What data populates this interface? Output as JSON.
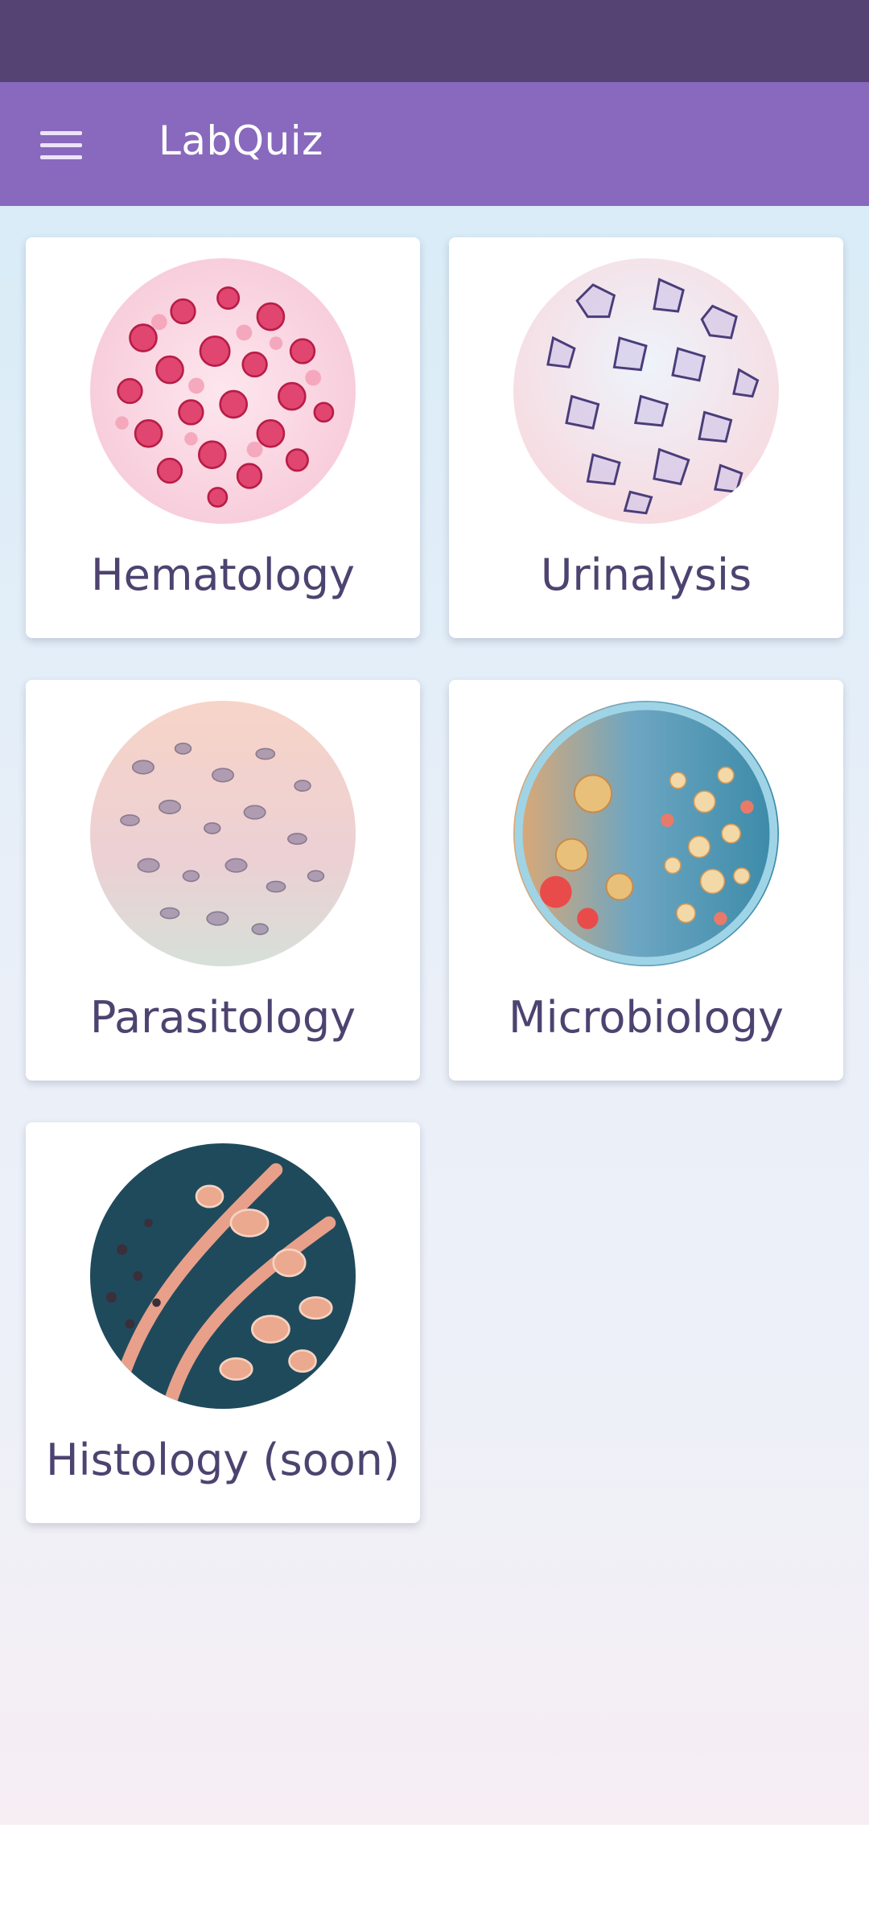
{
  "app": {
    "title": "LabQuiz",
    "menu_icon": "hamburger-menu-icon"
  },
  "colors": {
    "status_bar": "#544373",
    "app_bar": "#8869bd",
    "card_text": "#4d4370"
  },
  "categories": [
    {
      "label": "Hematology",
      "image": "red-blood-cells-micrograph"
    },
    {
      "label": "Urinalysis",
      "image": "urine-crystals-micrograph"
    },
    {
      "label": "Parasitology",
      "image": "parasite-smear-micrograph"
    },
    {
      "label": "Microbiology",
      "image": "bacterial-colonies-petri-dish"
    },
    {
      "label": "Histology (soon)",
      "image": "tissue-section-micrograph"
    }
  ]
}
